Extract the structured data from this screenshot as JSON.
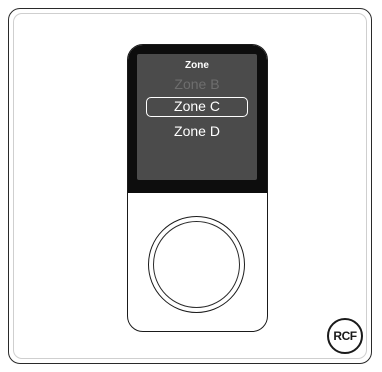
{
  "screen": {
    "title": "Zone",
    "items": [
      {
        "label": "Zone B",
        "state": "faded"
      },
      {
        "label": "Zone C",
        "state": "selected"
      },
      {
        "label": "Zone D",
        "state": "normal"
      }
    ],
    "background_color": "#4b4b4b",
    "text_color": "#ffffff"
  },
  "knob": {
    "icon": "rotary-encoder-knob"
  },
  "brand": {
    "logo_text": "RCF"
  }
}
